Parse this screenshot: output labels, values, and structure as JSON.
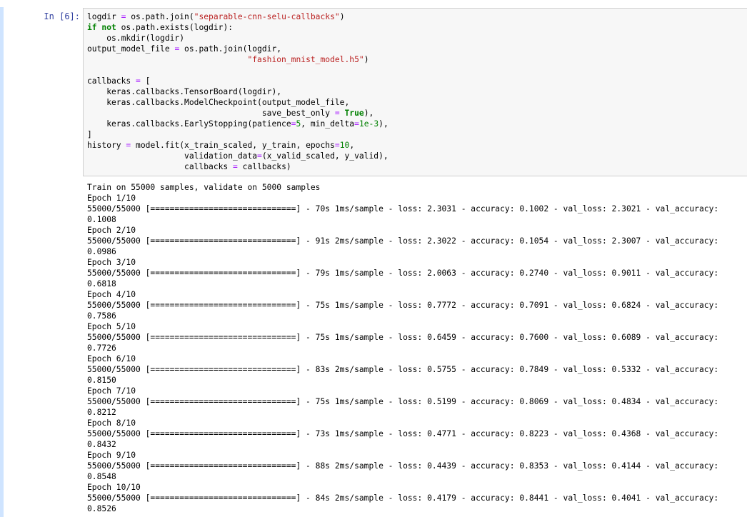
{
  "cell": {
    "prompt": "In  [6]:",
    "code_lines": [
      "logdir = os.path.join(\"separable-cnn-selu-callbacks\")",
      "if not os.path.exists(logdir):",
      "    os.mkdir(logdir)",
      "output_model_file = os.path.join(logdir,",
      "                                 \"fashion_mnist_model.h5\")",
      "",
      "callbacks = [",
      "    keras.callbacks.TensorBoard(logdir),",
      "    keras.callbacks.ModelCheckpoint(output_model_file,",
      "                                    save_best_only = True),",
      "    keras.callbacks.EarlyStopping(patience=5, min_delta=1e-3),",
      "]",
      "history = model.fit(x_train_scaled, y_train, epochs=10,",
      "                    validation_data=(x_valid_scaled, y_valid),",
      "                    callbacks = callbacks)"
    ],
    "output_lines": [
      "Train on 55000 samples, validate on 5000 samples",
      "Epoch 1/10",
      "55000/55000 [==============================] - 70s 1ms/sample - loss: 2.3031 - accuracy: 0.1002 - val_loss: 2.3021 - val_accuracy:",
      "0.1008",
      "Epoch 2/10",
      "55000/55000 [==============================] - 91s 2ms/sample - loss: 2.3022 - accuracy: 0.1054 - val_loss: 2.3007 - val_accuracy:",
      "0.0986",
      "Epoch 3/10",
      "55000/55000 [==============================] - 79s 1ms/sample - loss: 2.0063 - accuracy: 0.2740 - val_loss: 0.9011 - val_accuracy:",
      "0.6818",
      "Epoch 4/10",
      "55000/55000 [==============================] - 75s 1ms/sample - loss: 0.7772 - accuracy: 0.7091 - val_loss: 0.6824 - val_accuracy:",
      "0.7586",
      "Epoch 5/10",
      "55000/55000 [==============================] - 75s 1ms/sample - loss: 0.6459 - accuracy: 0.7600 - val_loss: 0.6089 - val_accuracy:",
      "0.7726",
      "Epoch 6/10",
      "55000/55000 [==============================] - 83s 2ms/sample - loss: 0.5755 - accuracy: 0.7849 - val_loss: 0.5332 - val_accuracy:",
      "0.8150",
      "Epoch 7/10",
      "55000/55000 [==============================] - 75s 1ms/sample - loss: 0.5199 - accuracy: 0.8069 - val_loss: 0.4834 - val_accuracy:",
      "0.8212",
      "Epoch 8/10",
      "55000/55000 [==============================] - 73s 1ms/sample - loss: 0.4771 - accuracy: 0.8223 - val_loss: 0.4368 - val_accuracy:",
      "0.8432",
      "Epoch 9/10",
      "55000/55000 [==============================] - 88s 2ms/sample - loss: 0.4439 - accuracy: 0.8353 - val_loss: 0.4144 - val_accuracy:",
      "0.8548",
      "Epoch 10/10",
      "55000/55000 [==============================] - 84s 2ms/sample - loss: 0.4179 - accuracy: 0.8441 - val_loss: 0.4041 - val_accuracy:",
      "0.8526"
    ]
  },
  "colors": {
    "prompt": "#303f9f",
    "keyword": "#008000",
    "string": "#ba2121",
    "number": "#008000",
    "operator": "#aa22ff",
    "input_background": "#f7f7f7",
    "input_border": "#cfcfcf",
    "selection_bar": "#cfe4ff"
  }
}
